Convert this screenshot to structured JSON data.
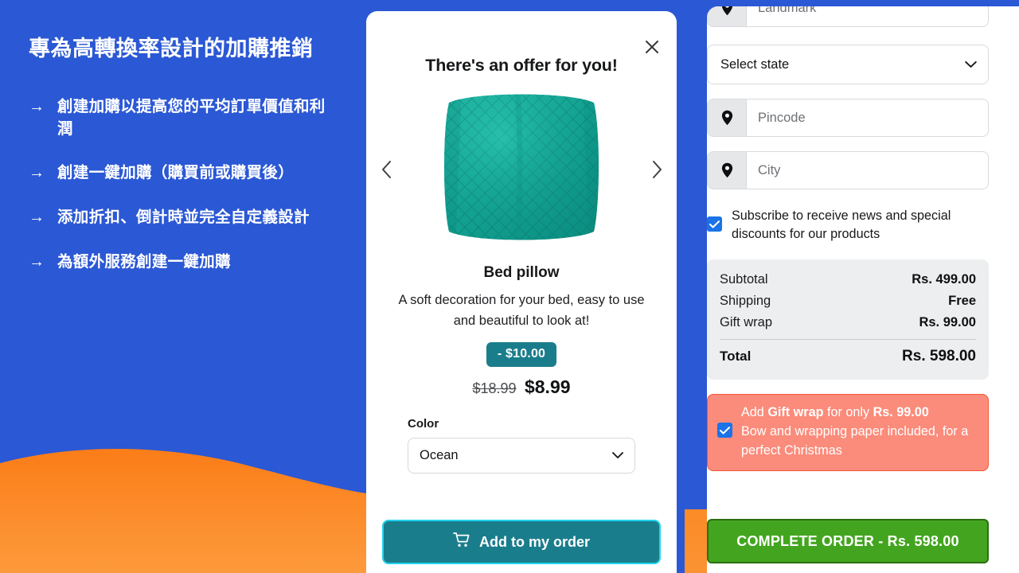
{
  "promo": {
    "title": "專為高轉換率設計的加購推銷",
    "bullet_marker": "→",
    "items": [
      "創建加購以提高您的平均訂單價值和利潤",
      "創建一鍵加購（購買前或購買後）",
      "添加折扣、倒計時並完全自定義設計",
      "為額外服務創建一鍵加購"
    ]
  },
  "offer_modal": {
    "close_icon": "close-icon",
    "heading": "There's an offer for you!",
    "prev_icon": "chevron-left-icon",
    "next_icon": "chevron-right-icon",
    "product_image_alt": "teal quilted bed pillow",
    "product_name": "Bed pillow",
    "product_description": "A soft decoration for your bed, easy to use and beautiful to look at!",
    "discount_badge": "- $10.00",
    "price_old": "$18.99",
    "price_new": "$8.99",
    "color_label": "Color",
    "color_selected": "Ocean",
    "color_chevron_icon": "chevron-down-icon",
    "add_button_label": "Add to my order",
    "add_button_icon": "shopping-cart-icon"
  },
  "checkout": {
    "fields": [
      {
        "name": "landmark",
        "placeholder": "Landmark",
        "icon": "map-pin-icon"
      },
      {
        "name": "pincode",
        "placeholder": "Pincode",
        "icon": "map-pin-icon"
      },
      {
        "name": "city",
        "placeholder": "City",
        "icon": "map-pin-icon"
      }
    ],
    "state_select": {
      "value": "Select state",
      "chevron_icon": "chevron-down-icon"
    },
    "subscribe": {
      "checked": true,
      "label": "Subscribe to receive news and special discounts for our products"
    },
    "summary": {
      "rows": [
        {
          "label": "Subtotal",
          "value": "Rs. 499.00"
        },
        {
          "label": "Shipping",
          "value": "Free"
        },
        {
          "label": "Gift wrap",
          "value": "Rs. 99.00"
        }
      ],
      "total_label": "Total",
      "total_value": "Rs. 598.00"
    },
    "giftwrap_upsell": {
      "checked": true,
      "line1_pre": "Add ",
      "line1_strong": "Gift wrap",
      "line1_mid": " for only ",
      "line1_price": "Rs. 99.00",
      "line2": "Bow and wrapping paper included, for a perfect Christmas"
    },
    "complete_button_label": "COMPLETE ORDER - Rs. 598.00"
  },
  "colors": {
    "background_blue": "#2b58d4",
    "wave_orange": "#fb8b26",
    "teal_accent": "#1a7d8c",
    "teal_border": "#22d3ee",
    "green_cta": "#43a51f",
    "coral_upsell": "#fb8b7a",
    "checkbox_blue": "#1a73e8"
  }
}
